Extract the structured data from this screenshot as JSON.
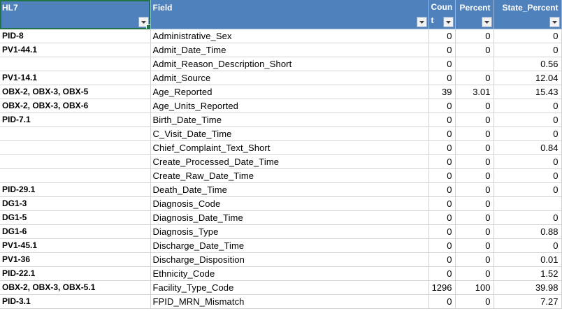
{
  "columns": {
    "hl7": "HL7",
    "field": "Field",
    "count": "Count",
    "percent": "Percent",
    "state_percent": "State_Percent"
  },
  "rows": [
    {
      "hl7": "PID-8",
      "field": "Administrative_Sex",
      "count": "0",
      "percent": "0",
      "state_percent": "0"
    },
    {
      "hl7": "PV1-44.1",
      "field": "Admit_Date_Time",
      "count": "0",
      "percent": "0",
      "state_percent": "0"
    },
    {
      "hl7": "",
      "field": "Admit_Reason_Description_Short",
      "count": "0",
      "percent": "",
      "state_percent": "0.56"
    },
    {
      "hl7": "PV1-14.1",
      "field": "Admit_Source",
      "count": "0",
      "percent": "0",
      "state_percent": "12.04"
    },
    {
      "hl7": "OBX-2, OBX-3, OBX-5",
      "field": "Age_Reported",
      "count": "39",
      "percent": "3.01",
      "state_percent": "15.43"
    },
    {
      "hl7": "OBX-2, OBX-3, OBX-6",
      "field": "Age_Units_Reported",
      "count": "0",
      "percent": "0",
      "state_percent": "0"
    },
    {
      "hl7": "PID-7.1",
      "field": "Birth_Date_Time",
      "count": "0",
      "percent": "0",
      "state_percent": "0"
    },
    {
      "hl7": "",
      "field": "C_Visit_Date_Time",
      "count": "0",
      "percent": "0",
      "state_percent": "0"
    },
    {
      "hl7": "",
      "field": "Chief_Complaint_Text_Short",
      "count": "0",
      "percent": "0",
      "state_percent": "0.84"
    },
    {
      "hl7": "",
      "field": "Create_Processed_Date_Time",
      "count": "0",
      "percent": "0",
      "state_percent": "0"
    },
    {
      "hl7": "",
      "field": "Create_Raw_Date_Time",
      "count": "0",
      "percent": "0",
      "state_percent": "0"
    },
    {
      "hl7": "PID-29.1",
      "field": "Death_Date_Time",
      "count": "0",
      "percent": "0",
      "state_percent": "0"
    },
    {
      "hl7": "DG1-3",
      "field": "Diagnosis_Code",
      "count": "0",
      "percent": "0",
      "state_percent": ""
    },
    {
      "hl7": "DG1-5",
      "field": "Diagnosis_Date_Time",
      "count": "0",
      "percent": "0",
      "state_percent": "0"
    },
    {
      "hl7": "DG1-6",
      "field": "Diagnosis_Type",
      "count": "0",
      "percent": "0",
      "state_percent": "0.88"
    },
    {
      "hl7": "PV1-45.1",
      "field": "Discharge_Date_Time",
      "count": "0",
      "percent": "0",
      "state_percent": "0"
    },
    {
      "hl7": "PV1-36",
      "field": "Discharge_Disposition",
      "count": "0",
      "percent": "0",
      "state_percent": "0.01"
    },
    {
      "hl7": "PID-22.1",
      "field": "Ethnicity_Code",
      "count": "0",
      "percent": "0",
      "state_percent": "1.52"
    },
    {
      "hl7": "OBX-2, OBX-3, OBX-5.1",
      "field": "Facility_Type_Code",
      "count": "1296",
      "percent": "100",
      "state_percent": "39.98"
    },
    {
      "hl7": "PID-3.1",
      "field": "FPID_MRN_Mismatch",
      "count": "0",
      "percent": "0",
      "state_percent": "7.27"
    }
  ]
}
